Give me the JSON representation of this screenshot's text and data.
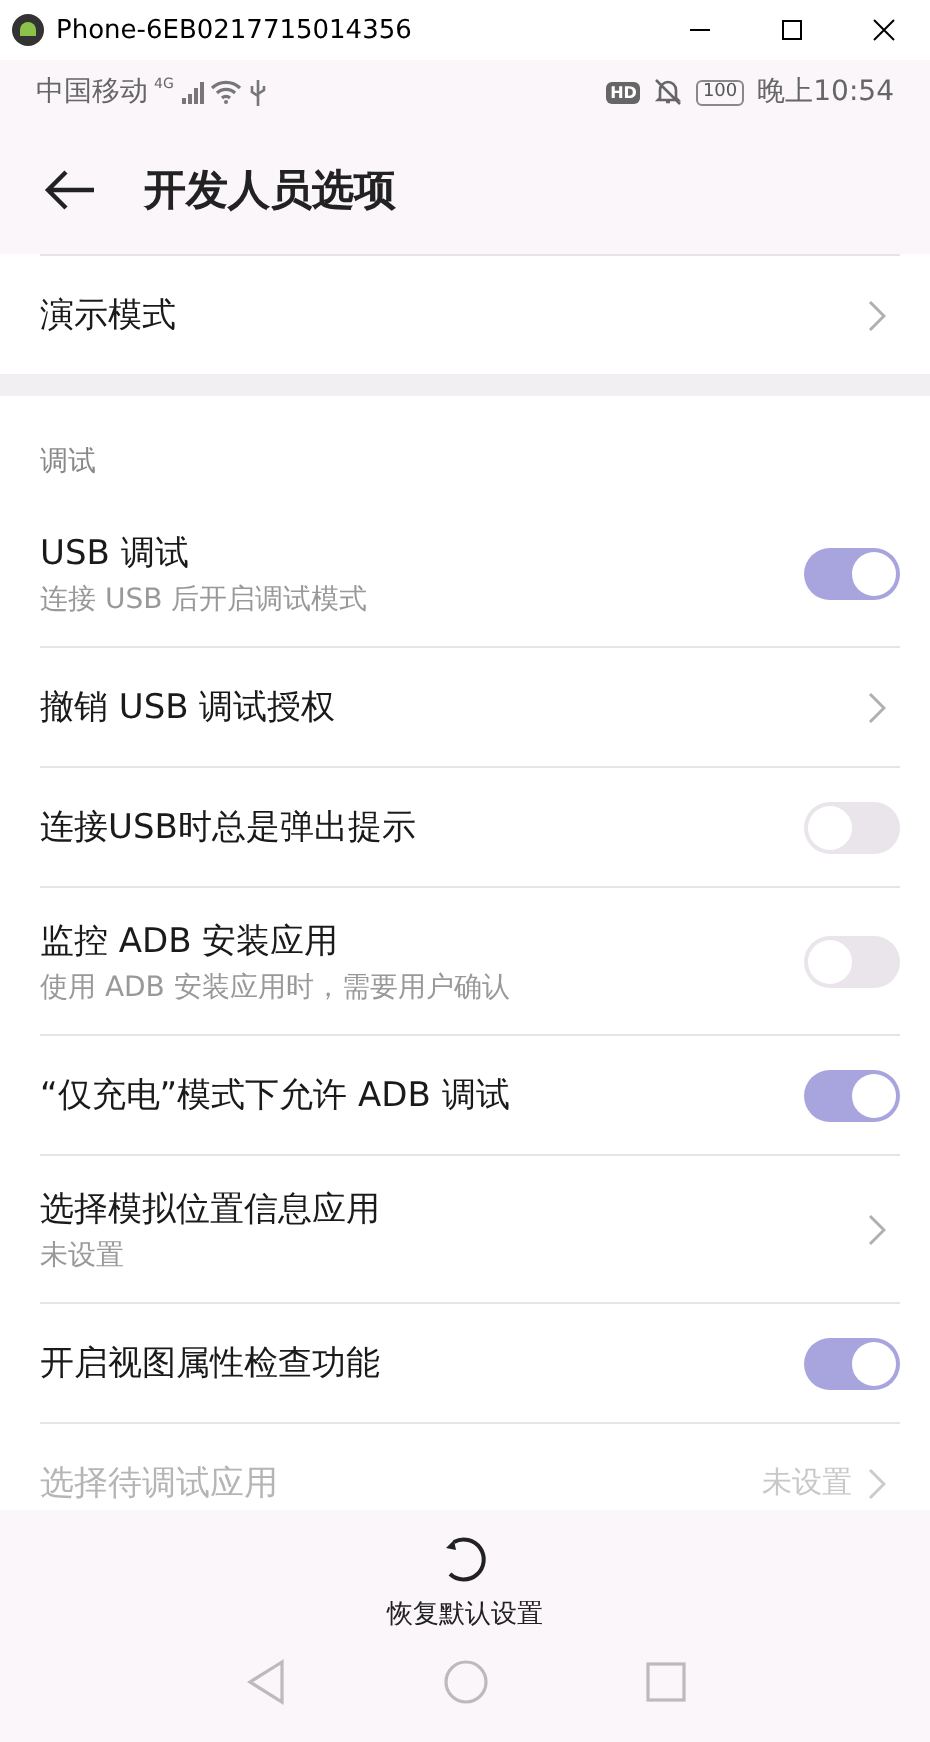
{
  "window": {
    "title": "Phone-6EB0217715014356"
  },
  "status_bar": {
    "carrier": "中国移动",
    "network": "4G",
    "hd": "HD",
    "battery": "100",
    "time": "晚上10:54"
  },
  "header": {
    "title": "开发人员选项"
  },
  "top_rows": [
    {
      "kind": "link",
      "title": "演示模式",
      "disabled": false
    }
  ],
  "sections": [
    {
      "title": "调试",
      "rows": [
        {
          "kind": "toggle",
          "title": "USB 调试",
          "subtitle": "连接 USB 后开启调试模式",
          "on": true,
          "disabled": false
        },
        {
          "kind": "link",
          "title": "撤销 USB 调试授权",
          "disabled": false
        },
        {
          "kind": "toggle",
          "title": "连接USB时总是弹出提示",
          "on": false,
          "disabled": false
        },
        {
          "kind": "toggle",
          "title": "监控 ADB 安装应用",
          "subtitle": "使用 ADB 安装应用时，需要用户确认",
          "on": false,
          "disabled": false
        },
        {
          "kind": "toggle",
          "title": "“仅充电”模式下允许 ADB 调试",
          "on": true,
          "disabled": false
        },
        {
          "kind": "link",
          "title": "选择模拟位置信息应用",
          "subtitle": "未设置",
          "disabled": false
        },
        {
          "kind": "toggle",
          "title": "开启视图属性检查功能",
          "on": true,
          "disabled": false
        },
        {
          "kind": "link",
          "title": "选择待调试应用",
          "value": "未设置",
          "disabled": true
        }
      ]
    }
  ],
  "reset_button": {
    "label": "恢复默认设置"
  }
}
